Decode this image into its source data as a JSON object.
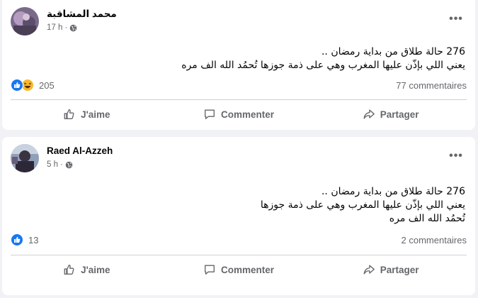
{
  "posts": [
    {
      "author": "محمد المشاقبة",
      "time": "17 h",
      "content_lines": [
        "276 حالة طلاق من بداية رمضان ..",
        "يعني اللي بإذّن عليها المغرب وهي على ذمة جوزها تُحمُد الله الف مره"
      ],
      "reaction_count": "205",
      "reaction_icons": [
        "like",
        "haha"
      ],
      "comments": "77 commentaires"
    },
    {
      "author": "Raed Al-Azzeh",
      "time": "5 h",
      "content_lines": [
        "276 حالة طلاق من بداية رمضان ..",
        "يعني اللي بإذّن عليها المغرب وهي على ذمة جوزها",
        "تُحمُد الله الف مره"
      ],
      "reaction_count": "13",
      "reaction_icons": [
        "like"
      ],
      "comments": "2 commentaires"
    }
  ],
  "actions": {
    "like": "J'aime",
    "comment": "Commenter",
    "share": "Partager"
  },
  "colors": {
    "like_blue": "#1877f2",
    "haha_yellow": "#f7b928",
    "secondary_text": "#65676b",
    "feed_bg": "#f0f2f5"
  }
}
